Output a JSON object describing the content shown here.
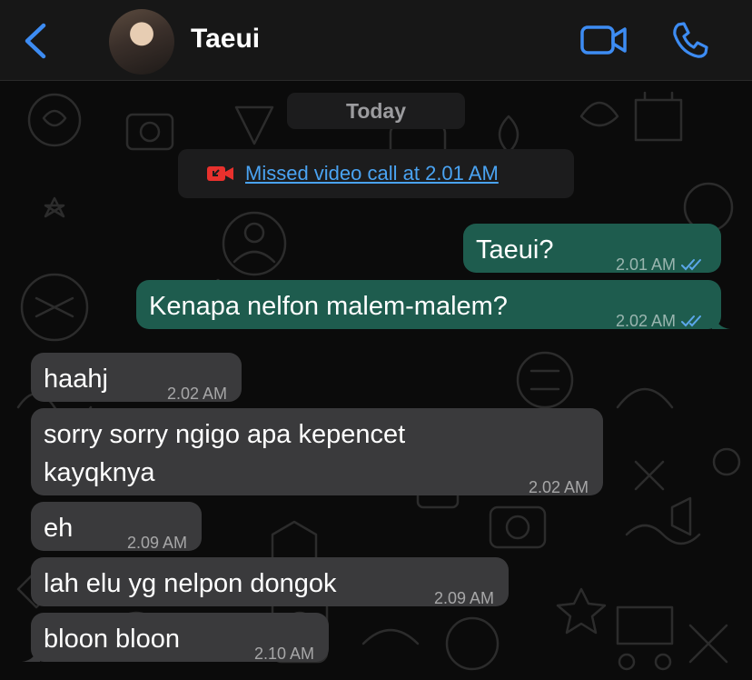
{
  "header": {
    "back_icon": "chevron-left-icon",
    "contact_name": "Taeui",
    "video_icon": "video-camera-icon",
    "call_icon": "phone-icon",
    "accent_color": "#3d8cf3"
  },
  "chat": {
    "date_separator": "Today",
    "missed_call": {
      "icon": "missed-video-call-icon",
      "text": "Missed video call at 2.01 AM"
    },
    "messages": [
      {
        "direction": "outgoing",
        "text": "Taeui?",
        "time": "2.01 AM",
        "status": "read"
      },
      {
        "direction": "outgoing",
        "text": "Kenapa nelfon malem-malem?",
        "time": "2.02 AM",
        "status": "read"
      },
      {
        "direction": "incoming",
        "text": "haahj",
        "time": "2.02 AM"
      },
      {
        "direction": "incoming",
        "text": "sorry sorry ngigo apa kepencet kayqknya",
        "time": "2.02 AM"
      },
      {
        "direction": "incoming",
        "text": "eh",
        "time": "2.09 AM"
      },
      {
        "direction": "incoming",
        "text": "lah elu yg nelpon dongok",
        "time": "2.09 AM"
      },
      {
        "direction": "incoming",
        "text": "bloon bloon",
        "time": "2.10 AM"
      }
    ],
    "colors": {
      "outgoing_bubble": "#1e5c4e",
      "incoming_bubble": "#3a3a3c",
      "read_ticks": "#5ba7ea",
      "missed_call_red": "#e8312d",
      "link_blue": "#4aa3f2"
    }
  }
}
